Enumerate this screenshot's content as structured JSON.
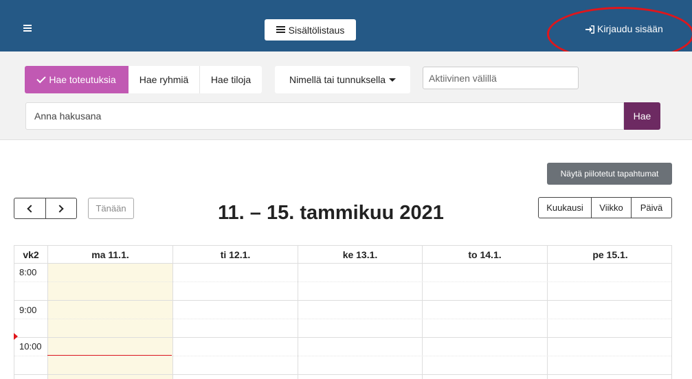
{
  "topbar": {
    "content_list_label": "Sisältölistaus",
    "login_label": "Kirjaudu sisään",
    "icons": {
      "menu": "hamburger-menu-icon",
      "list": "list-icon",
      "login": "sign-in-icon"
    },
    "colors": {
      "background": "#255986",
      "highlight": "#e0161b"
    }
  },
  "search": {
    "tabs": [
      {
        "label": "Hae toteutuksia",
        "active": true
      },
      {
        "label": "Hae ryhmiä",
        "active": false
      },
      {
        "label": "Hae tiloja",
        "active": false
      }
    ],
    "filter_dropdown": "Nimellä tai tunnuksella",
    "active_range_placeholder": "Aktiivinen välillä",
    "query_placeholder": "Anna hakusana",
    "submit_label": "Hae",
    "colors": {
      "active_tab": "#c159b3",
      "submit": "#6d2a62"
    }
  },
  "controls": {
    "show_hidden_label": "Näytä piilotetut tapahtumat",
    "today_label": "Tänään",
    "date_range": "11. – 15. tammikuu 2021",
    "views": [
      "Kuukausi",
      "Viikko",
      "Päivä"
    ]
  },
  "calendar": {
    "week_label": "vk2",
    "days": [
      "ma 11.1.",
      "ti 12.1.",
      "ke 13.1.",
      "to 14.1.",
      "pe 15.1."
    ],
    "today_index": 0,
    "times": [
      "8:00",
      "9:00",
      "10:00"
    ],
    "colors": {
      "today_bg": "#fcf8e3",
      "now_indicator": "#e0161b"
    }
  }
}
